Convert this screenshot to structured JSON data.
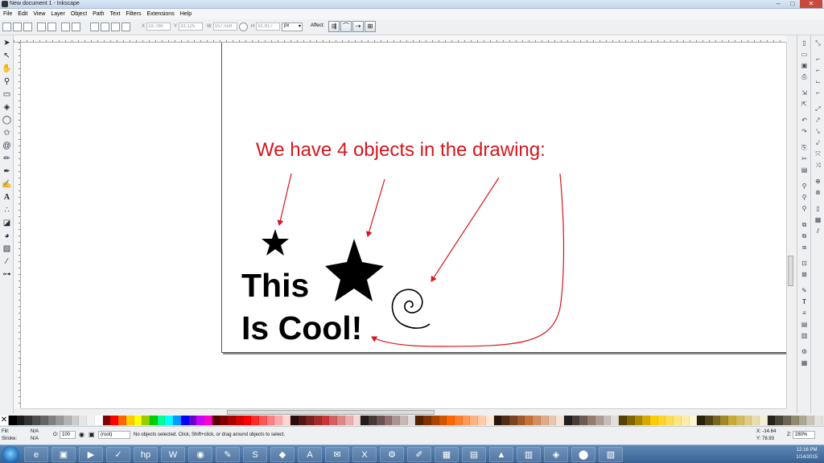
{
  "window": {
    "title": "New document 1 - Inkscape",
    "minimize": "–",
    "maximize": "□",
    "close": "✕"
  },
  "menu": [
    "File",
    "Edit",
    "View",
    "Layer",
    "Object",
    "Path",
    "Text",
    "Filters",
    "Extensions",
    "Help"
  ],
  "controls": {
    "x_label": "X",
    "x_value": "18.784",
    "y_label": "Y",
    "y_value": "33.125",
    "w_label": "W",
    "w_value": "157.559",
    "h_label": "H",
    "h_value": "91.817",
    "unit": "px",
    "affect_label": "Affect:"
  },
  "canvas": {
    "annotation": "We have 4 objects in the drawing:",
    "text_line1": "This",
    "text_line2": "Is Cool!",
    "annotation_color": "#d6161c"
  },
  "palette_colors": [
    "#000000",
    "#1a1a1a",
    "#333333",
    "#4d4d4d",
    "#666666",
    "#808080",
    "#999999",
    "#b3b3b3",
    "#cccccc",
    "#e6e6e6",
    "#f2f2f2",
    "#ffffff",
    "#800000",
    "#ff0000",
    "#ff6600",
    "#ffcc00",
    "#ffff00",
    "#99cc00",
    "#00cc00",
    "#00ff99",
    "#00ffff",
    "#0099ff",
    "#0000ff",
    "#6600cc",
    "#cc00ff",
    "#ff00cc",
    "#550000",
    "#800000",
    "#aa0000",
    "#d40000",
    "#ff0000",
    "#ff2a2a",
    "#ff5555",
    "#ff8080",
    "#ffaaaa",
    "#ffd5d5",
    "#280b0b",
    "#501616",
    "#782121",
    "#a02c2c",
    "#c83737",
    "#d35f5f",
    "#de8787",
    "#e9afaf",
    "#f4d7d7",
    "#241c1c",
    "#483737",
    "#6c5353",
    "#916f6f",
    "#ac9393",
    "#c8b7b7",
    "#e3dbdb",
    "#552200",
    "#803300",
    "#aa4400",
    "#d45500",
    "#ff6600",
    "#ff7f2a",
    "#ff9955",
    "#ffb380",
    "#ffccaa",
    "#ffe6d5",
    "#28170b",
    "#502d16",
    "#784421",
    "#a05a2c",
    "#c87137",
    "#d38d5f",
    "#deaa87",
    "#e9c6af",
    "#f4e3d7",
    "#241f1c",
    "#483e37",
    "#6c5d53",
    "#917c6f",
    "#ac9d93",
    "#c8beb7",
    "#e3dedb",
    "#554400",
    "#806600",
    "#aa8800",
    "#d4aa00",
    "#ffcc00",
    "#ffd42a",
    "#ffdd55",
    "#ffe680",
    "#ffeeaa",
    "#fff6d5",
    "#28220b",
    "#504416",
    "#786721",
    "#a0892c",
    "#c8ab37",
    "#d3bc5f",
    "#decd87",
    "#e9ddaf",
    "#f4eed7",
    "#24221c",
    "#484537",
    "#6c6753",
    "#918a6f",
    "#aca793",
    "#c8c4b7",
    "#e3e2db"
  ],
  "status": {
    "fill_label": "Fill:",
    "fill_value": "N/A",
    "stroke_label": "Stroke:",
    "stroke_value": "N/A",
    "opacity_label": "O:",
    "opacity_value": "100",
    "layer_value": "(root)",
    "message": "No objects selected. Click, Shift+click, or drag around objects to select.",
    "x_readout": "X: -14.64",
    "y_readout": "Y: 78.93",
    "z_label": "Z:",
    "zoom": "280%"
  },
  "taskbar": {
    "time": "12:16 PM",
    "date": "1/14/2015",
    "apps": [
      "ie-icon",
      "folder-icon",
      "media-player-icon",
      "check-icon",
      "hp-icon",
      "word-icon",
      "chrome-icon",
      "paint-icon",
      "skype-icon",
      "utility-icon",
      "acrobat-icon",
      "outlook-icon",
      "excel-icon",
      "python-icon",
      "notes-icon",
      "calculator-icon",
      "notepad-icon",
      "vlc-icon",
      "clipboard-icon",
      "network-icon",
      "inkscape-icon",
      "photo-icon"
    ],
    "glyphs": [
      "e",
      "▣",
      "▶",
      "✓",
      "hp",
      "W",
      "◉",
      "✎",
      "S",
      "◆",
      "A",
      "✉",
      "X",
      "⚙",
      "✐",
      "▦",
      "▤",
      "▲",
      "▥",
      "◈",
      "⬤",
      "▧"
    ]
  }
}
